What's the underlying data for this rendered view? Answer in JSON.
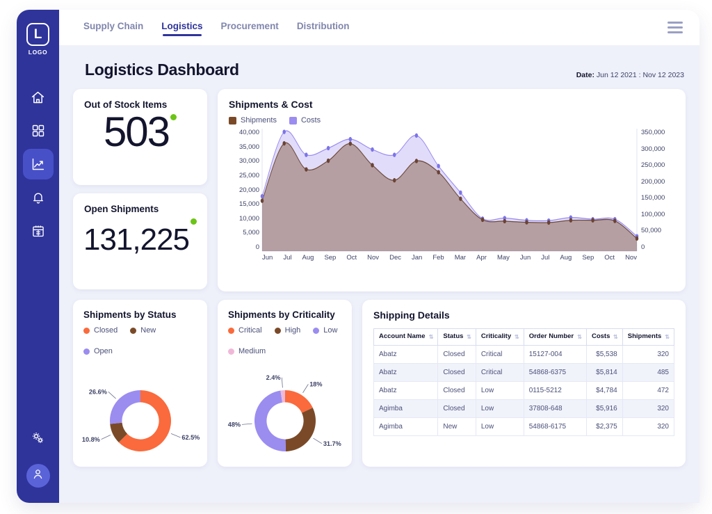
{
  "brand": {
    "logo_letter": "L",
    "logo_text": "LOGO",
    "primary": "#2f349b",
    "accent_green": "#6cc417"
  },
  "nav": {
    "items": [
      {
        "name": "home",
        "icon": "home-icon",
        "active": false
      },
      {
        "name": "dashboard",
        "icon": "grid-icon",
        "active": false
      },
      {
        "name": "analytics",
        "icon": "line-chart-icon",
        "active": true
      },
      {
        "name": "alerts",
        "icon": "bell-icon",
        "active": false
      },
      {
        "name": "calendar",
        "icon": "calendar-icon",
        "active": false
      }
    ],
    "bottom": [
      {
        "name": "settings",
        "icon": "gears-icon"
      },
      {
        "name": "profile",
        "icon": "user-icon"
      }
    ]
  },
  "topbar": {
    "tabs": [
      {
        "label": "Supply Chain",
        "active": false
      },
      {
        "label": "Logistics",
        "active": true
      },
      {
        "label": "Procurement",
        "active": false
      },
      {
        "label": "Distribution",
        "active": false
      }
    ],
    "menu_icon": "hamburger-icon"
  },
  "header": {
    "title": "Logistics Dashboard",
    "date_label": "Date:",
    "date_range": "Jun 12 2021 : Nov 12 2023"
  },
  "kpis": [
    {
      "title": "Out of Stock Items",
      "value": "503",
      "indicator_color": "#6cc417"
    },
    {
      "title": "Open Shipments",
      "value": "131,225",
      "indicator_color": "#6cc417"
    }
  ],
  "chart_data": [
    {
      "id": "shipments-cost",
      "type": "area",
      "title": "Shipments & Cost",
      "xlabel": "",
      "ylabel": "",
      "grid": false,
      "legend_position": "top-left",
      "legend": [
        {
          "name": "Shipments",
          "color": "#7a4a28"
        },
        {
          "name": "Costs",
          "color": "#9b8cf0"
        }
      ],
      "categories": [
        "Jun",
        "Jul",
        "Aug",
        "Sep",
        "Oct",
        "Nov",
        "Dec",
        "Jan",
        "Feb",
        "Mar",
        "Apr",
        "May",
        "Jun",
        "Jul",
        "Aug",
        "Sep",
        "Oct",
        "Nov"
      ],
      "y_left_ticks": [
        "40,000",
        "35,000",
        "30,000",
        "25,000",
        "20,000",
        "15,000",
        "10,000",
        "5,000",
        "0"
      ],
      "y_right_ticks": [
        "350,000",
        "300,000",
        "250,000",
        "200,000",
        "150,000",
        "100,000",
        "50,000",
        "0"
      ],
      "ylim": [
        0,
        43750
      ],
      "ylim_right": [
        0,
        382813
      ],
      "series": [
        {
          "name": "Shipments",
          "color": "#7a4a28",
          "axis": "left",
          "values": [
            18000,
            38500,
            29200,
            32300,
            38400,
            30700,
            25300,
            32200,
            28200,
            18700,
            11200,
            10700,
            10300,
            10200,
            11000,
            11000,
            10800,
            4500
          ]
        },
        {
          "name": "Costs",
          "color": "#9b8cf0",
          "axis": "left",
          "values": [
            19600,
            42600,
            34400,
            36800,
            40000,
            36300,
            34400,
            41300,
            30400,
            20900,
            11600,
            11800,
            11000,
            10900,
            12000,
            11400,
            11400,
            5300
          ]
        }
      ]
    },
    {
      "id": "shipments-by-status",
      "type": "pie",
      "title": "Shipments by Status",
      "legend_position": "top",
      "labels": [
        "Closed",
        "New",
        "Open"
      ],
      "values": [
        62.5,
        10.8,
        26.6
      ],
      "value_labels": [
        "62.5%",
        "10.8%",
        "26.6%"
      ],
      "colors": [
        "#fa6a3c",
        "#7a4a28",
        "#9b8cf0"
      ]
    },
    {
      "id": "shipments-by-criticality",
      "type": "pie",
      "title": "Shipments by Criticality",
      "legend_position": "top",
      "labels": [
        "Critical",
        "High",
        "Low",
        "Medium"
      ],
      "values": [
        18.0,
        31.7,
        48.0,
        2.4
      ],
      "value_labels": [
        "18%",
        "31.7%",
        "48%",
        "2.4%"
      ],
      "colors": [
        "#fa6a3c",
        "#7a4a28",
        "#9b8cf0",
        "#f0b8d8"
      ]
    }
  ],
  "table": {
    "title": "Shipping Details",
    "columns": [
      {
        "label": "Account Name",
        "sortable": true,
        "align": "left"
      },
      {
        "label": "Status",
        "sortable": true,
        "align": "left"
      },
      {
        "label": "Criticality",
        "sortable": true,
        "align": "left"
      },
      {
        "label": "Order Number",
        "sortable": true,
        "align": "left"
      },
      {
        "label": "Costs",
        "sortable": true,
        "align": "right"
      },
      {
        "label": "Shipments",
        "sortable": true,
        "align": "right"
      }
    ],
    "rows": [
      [
        "Abatz",
        "Closed",
        "Critical",
        "15127-004",
        "$5,538",
        "320"
      ],
      [
        "Abatz",
        "Closed",
        "Critical",
        "54868-6375",
        "$5,814",
        "485"
      ],
      [
        "Abatz",
        "Closed",
        "Low",
        "0115-5212",
        "$4,784",
        "472"
      ],
      [
        "Agimba",
        "Closed",
        "Low",
        "37808-648",
        "$5,916",
        "320"
      ],
      [
        "Agimba",
        "New",
        "Low",
        "54868-6175",
        "$2,375",
        "320"
      ]
    ]
  }
}
